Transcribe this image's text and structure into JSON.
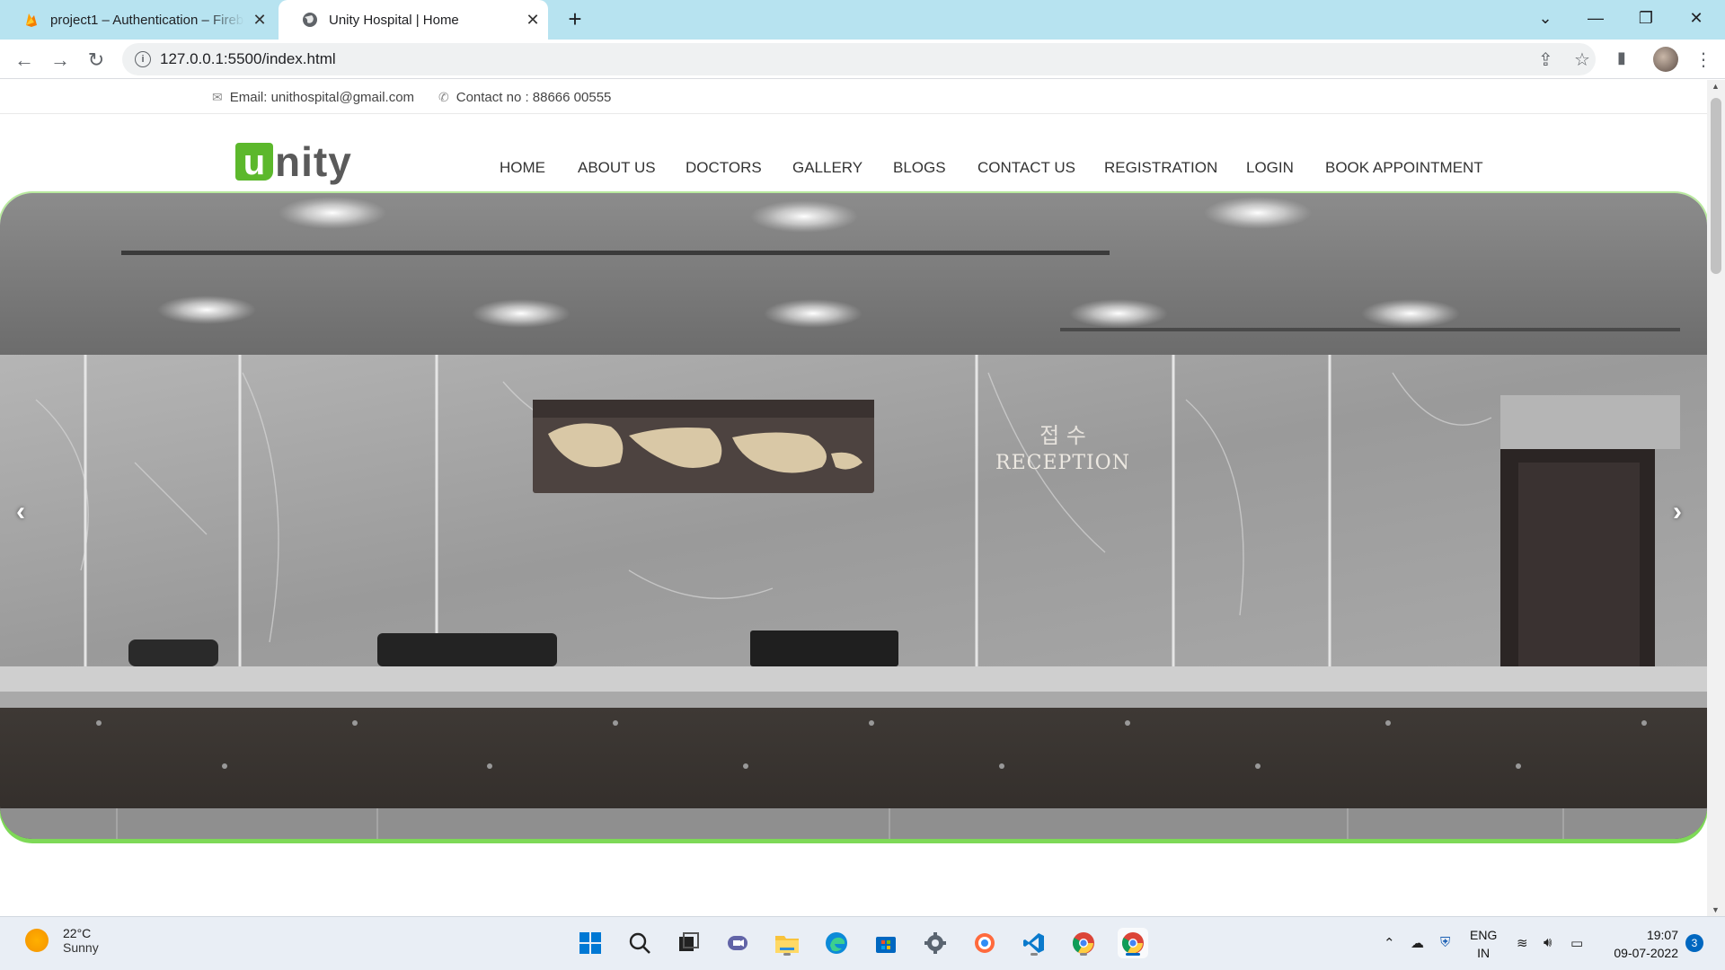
{
  "browser": {
    "tabs": [
      {
        "title": "project1 – Authentication – Fireb",
        "active": false
      },
      {
        "title": "Unity Hospital | Home",
        "active": true
      }
    ],
    "url": "127.0.0.1:5500/index.html"
  },
  "topbar": {
    "email": "Email: unithospital@gmail.com",
    "contact": "Contact no : 88666 00555"
  },
  "logo": {
    "letter": "u",
    "rest": "nity"
  },
  "nav": {
    "items": [
      "HOME",
      "ABOUT US",
      "DOCTORS",
      "GALLERY",
      "BLOGS",
      "CONTACT US",
      "REGISTRATION",
      "LOGIN",
      "BOOK APPOINTMENT"
    ]
  },
  "hero": {
    "sign_korean": "접 수",
    "sign_text": "RECEPTION",
    "prev": "‹",
    "next": "›"
  },
  "taskbar": {
    "temperature": "22°C",
    "condition": "Sunny",
    "lang_top": "ENG",
    "lang_bottom": "IN",
    "time": "19:07",
    "date": "09-07-2022",
    "notifications": "3"
  },
  "colors": {
    "brand_green": "#5cb82c",
    "tab_bar": "#b7e3f0",
    "hero_border": "#7ed957"
  }
}
